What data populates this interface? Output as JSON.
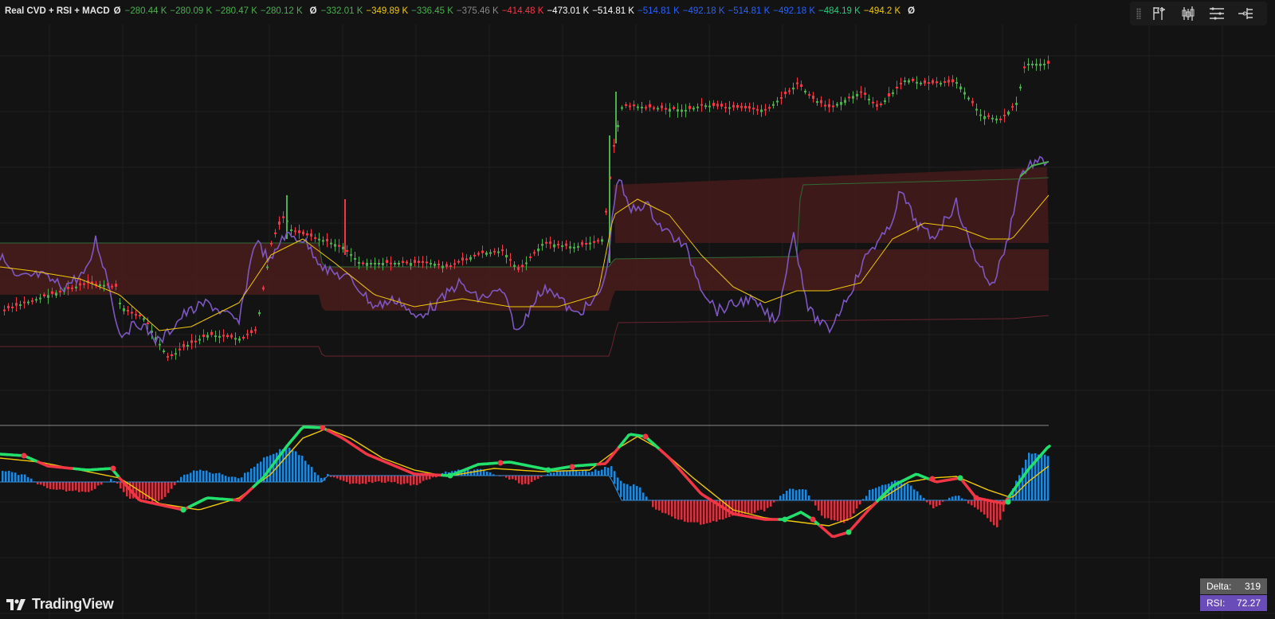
{
  "legend": {
    "indicator_name": "Real CVD + RSI + MACD",
    "symbol_a": "Ø",
    "symbol_b": "Ø",
    "symbol_c": "Ø",
    "values": [
      {
        "text": "−280.44 K",
        "color": "#4caf50"
      },
      {
        "text": "−280.09 K",
        "color": "#4caf50"
      },
      {
        "text": "−280.47 K",
        "color": "#4caf50"
      },
      {
        "text": "−280.12 K",
        "color": "#4caf50"
      },
      {
        "text": "−332.01 K",
        "color": "#4caf50"
      },
      {
        "text": "−349.89 K",
        "color": "#f0c808"
      },
      {
        "text": "−336.45 K",
        "color": "#4caf50"
      },
      {
        "text": "−375.46 K",
        "color": "#888888"
      },
      {
        "text": "−414.48 K",
        "color": "#f23645"
      },
      {
        "text": "−473.01 K",
        "color": "#ffffff"
      },
      {
        "text": "−514.81 K",
        "color": "#ffffff"
      },
      {
        "text": "−514.81 K",
        "color": "#2962ff"
      },
      {
        "text": "−492.18 K",
        "color": "#2962ff"
      },
      {
        "text": "−514.81 K",
        "color": "#2962ff"
      },
      {
        "text": "−492.18 K",
        "color": "#2962ff"
      },
      {
        "text": "−484.19 K",
        "color": "#22d07a"
      },
      {
        "text": "−494.2 K",
        "color": "#f0c808"
      }
    ]
  },
  "toolbar": {
    "icons": [
      "flag-marker-icon",
      "candlestick-icon",
      "horizontal-lines-icon",
      "arrow-lines-icon"
    ]
  },
  "branding": {
    "logo_text": "TradingView"
  },
  "badges": {
    "delta_label": "Delta:",
    "delta_value": "319",
    "rsi_label": "RSI:",
    "rsi_value": "72.27"
  },
  "colors": {
    "background": "#131313",
    "candle_up": "#4caf50",
    "candle_down": "#f23645",
    "rsi_line": "#7e57c2",
    "rsi_ma": "#f0c808",
    "band_fill": "#4a1c1c",
    "macd_up": "#22e06b",
    "macd_down": "#f23645",
    "hist_pos": "#2196f3",
    "hist_neg": "#f23645"
  }
}
